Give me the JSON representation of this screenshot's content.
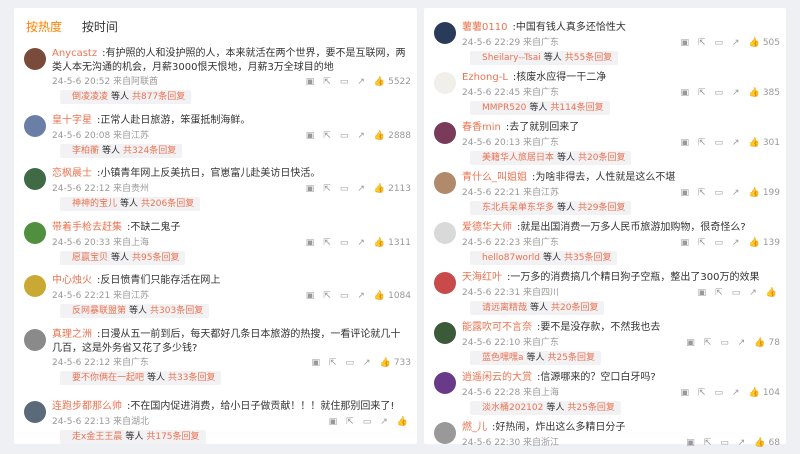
{
  "sort": {
    "hot": "按热度",
    "time": "按时间"
  },
  "left": [
    {
      "user": "Anycastz",
      "text": ":有护照的人和没护照的人，本来就活在两个世界，要不是互联网，两类人本无沟通的机会，月薪3000恨天恨地，月薪3万全球目的地",
      "time": "24-5-6 20:52 来自阿联酋",
      "likes": "5522",
      "reply_user": "倒凌凌凌",
      "reply_mid": "等人",
      "reply_count": "共877条回复"
    },
    {
      "user": "皇十字星",
      "text": ":正常人赴日旅游，笨蛋抵制海鲜。",
      "time": "24-5-6 20:08 来自江苏",
      "likes": "2888",
      "reply_user": "李柏蘅",
      "reply_mid": "等人",
      "reply_count": "共324条回复"
    },
    {
      "user": "恋枫晨士",
      "text": ":小镇青年网上反美抗日，官崽富儿赴美访日快活。",
      "time": "24-5-6 22:12 来自贵州",
      "likes": "2113",
      "reply_user": "神神的宝儿",
      "reply_mid": "等人",
      "reply_count": "共206条回复"
    },
    {
      "user": "带着手枪去赶集",
      "text": ":不缺二鬼子",
      "time": "24-5-6 20:33 来自上海",
      "likes": "1311",
      "reply_user": "愿赢宝贝",
      "reply_mid": "等人",
      "reply_count": "共95条回复"
    },
    {
      "user": "中心烛火",
      "text": ":反日愤青们只能存活在网上",
      "time": "24-5-6 22:21 来自江苏",
      "likes": "1084",
      "reply_user": "反网暴联盟第",
      "reply_mid": "等人",
      "reply_count": "共303条回复"
    },
    {
      "user": "真理之洲",
      "text": ":日漫从五一前到后，每天都好几条日本旅游的热搜，一看评论就几十几百，这是外务省又花了多少钱?",
      "time": "24-5-6 22:12 来自广东",
      "likes": "733",
      "reply_user": "要不你俩在一起吧",
      "reply_mid": "等人",
      "reply_count": "共33条回复"
    },
    {
      "user": "连跑步都那么帅",
      "text": ":不在国内促进消费，给小日子做贡献！！！就住那别回来了!",
      "time": "24-5-6 22:13 来自湖北",
      "likes": "",
      "reply_user": "走x金王王晨",
      "reply_mid": "等人",
      "reply_count": "共175条回复"
    }
  ],
  "right": [
    {
      "user": "薯薯0110",
      "text": ":中国有钱人真多还恰性大",
      "time": "24-5-6 22:29 来自广东",
      "likes": "505",
      "reply_user": "Sheilary--Tsai",
      "reply_mid": "等人",
      "reply_count": "共55条回复"
    },
    {
      "user": "Ezhong-L",
      "text": ":核废水应得一干二净",
      "time": "24-5-6 22:45 来自广东",
      "likes": "385",
      "reply_user": "MMPR520",
      "reply_mid": "等人",
      "reply_count": "共114条回复"
    },
    {
      "user": "春香min",
      "text": ":去了就别回来了",
      "time": "24-5-6 20:13 来自广东",
      "likes": "301",
      "reply_user": "美籍华人旅居日本",
      "reply_mid": "等人",
      "reply_count": "共20条回复"
    },
    {
      "user": "青什么_叫姐姐",
      "text": ":为啥非得去，人性就是这么不堪",
      "time": "24-5-6 22:21 来自江苏",
      "likes": "199",
      "reply_user": "东北兵呆单东华多",
      "reply_mid": "等人",
      "reply_count": "共29条回复"
    },
    {
      "user": "爱德华大师",
      "text": ":就是出国消费一万多人民币旅游加购物，很奇怪么?",
      "time": "24-5-6 22:23 来自广东",
      "likes": "139",
      "reply_user": "hello87world",
      "reply_mid": "等人",
      "reply_count": "共35条回复"
    },
    {
      "user": "天海红叶",
      "text": ":一万多的消费搞几个精日狗子空瓶，整出了300万的效果",
      "time": "24-5-6 22:31 来自四川",
      "likes": "",
      "reply_user": "请远离精哉",
      "reply_mid": "等人",
      "reply_count": "共20条回复"
    },
    {
      "user": "能露吹可不言奈",
      "text": ":要不是没存款，不然我也去",
      "time": "24-5-6 22:10 来自广东",
      "likes": "78",
      "reply_user": "蓝色嘿嘿a",
      "reply_mid": "等人",
      "reply_count": "共25条回复"
    },
    {
      "user": "逍遥闲云的大赏",
      "text": ":信源哪来的？空口白牙吗?",
      "time": "24-5-6 22:28 来自上海",
      "likes": "104",
      "reply_user": "淡水桶202102",
      "reply_mid": "等人",
      "reply_count": "共25条回复"
    },
    {
      "user": "燃_儿",
      "text": ":好热闹，炸出这么多精日分子",
      "time": "24-5-6 22:30 来自浙江",
      "likes": "68",
      "reply_user": "",
      "reply_mid": "",
      "reply_count": ""
    }
  ],
  "avatar_colors": {
    "left": [
      "#7a4a3a",
      "#6b7fa6",
      "#3f6a45",
      "#4f8f3e",
      "#c9a934",
      "#8a8a8a",
      "#5a6a7a"
    ],
    "right": [
      "#2a3a5a",
      "#f0efe9",
      "#7a3a5a",
      "#b08a6a",
      "#d9d9d9",
      "#c84a4a",
      "#3a5a3a",
      "#6a3a8a",
      "#999999"
    ]
  },
  "icons": {
    "share": "share-icon",
    "comment": "comment-icon",
    "like": "like-icon",
    "image": "image-icon",
    "expand": "expand-icon"
  },
  "accent": "#ff8200",
  "username_color": "#eb7350"
}
